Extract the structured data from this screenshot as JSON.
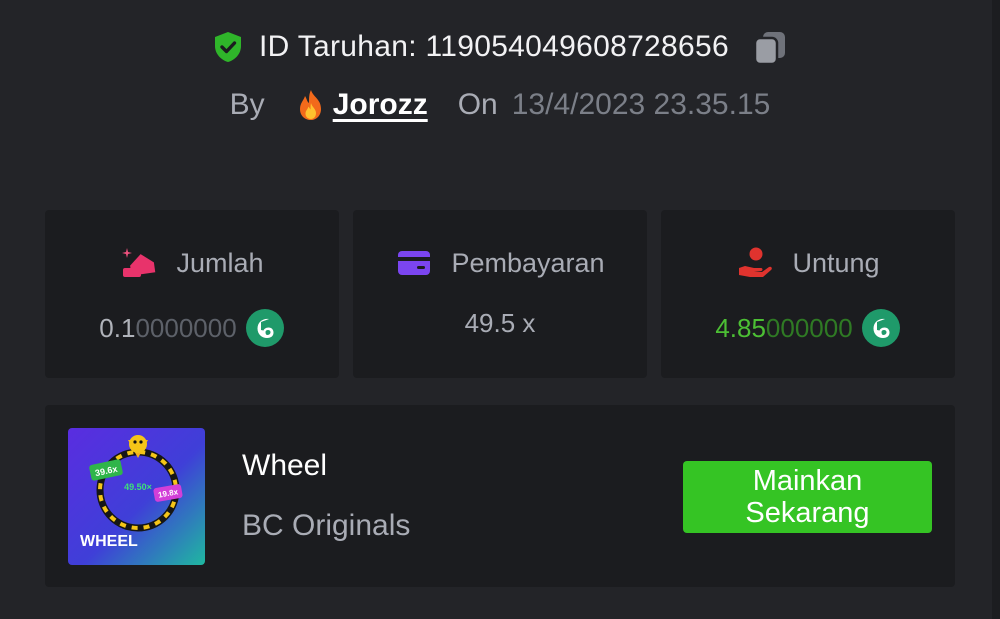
{
  "header": {
    "bet_id_label": "ID Taruhan: 119054049608728656",
    "by_label": "By",
    "username": "Jorozz",
    "on_label": "On",
    "datetime": "13/4/2023 23.35.15"
  },
  "stats": {
    "amount": {
      "label": "Jumlah",
      "value_bright": "0.1",
      "value_dim": "0000000"
    },
    "payout": {
      "label": "Pembayaran",
      "value": "49.5 x"
    },
    "profit": {
      "label": "Untung",
      "value_bright": "4.85",
      "value_dim": "000000"
    }
  },
  "game": {
    "title": "Wheel",
    "provider": "BC Originals",
    "play_button": "Mainkan Sekarang",
    "thumbnail": {
      "label": "WHEEL",
      "chip_left": "39.6x",
      "chip_center": "49.50×",
      "chip_right": "19.8x"
    }
  },
  "colors": {
    "background": "#232428",
    "card": "#1b1c1f",
    "accent_green": "#35c424",
    "profit_green": "#4cbf34",
    "amount_pink": "#e8336b",
    "payout_purple": "#7b45f0",
    "profit_red": "#e0332e"
  },
  "icons": {
    "verified": "shield-check-icon",
    "copy": "copy-icon",
    "user_badge": "fire-icon",
    "amount": "bet-amount-icon",
    "payout": "card-icon",
    "profit": "hand-coin-icon",
    "currency": "bc-coin-icon"
  }
}
